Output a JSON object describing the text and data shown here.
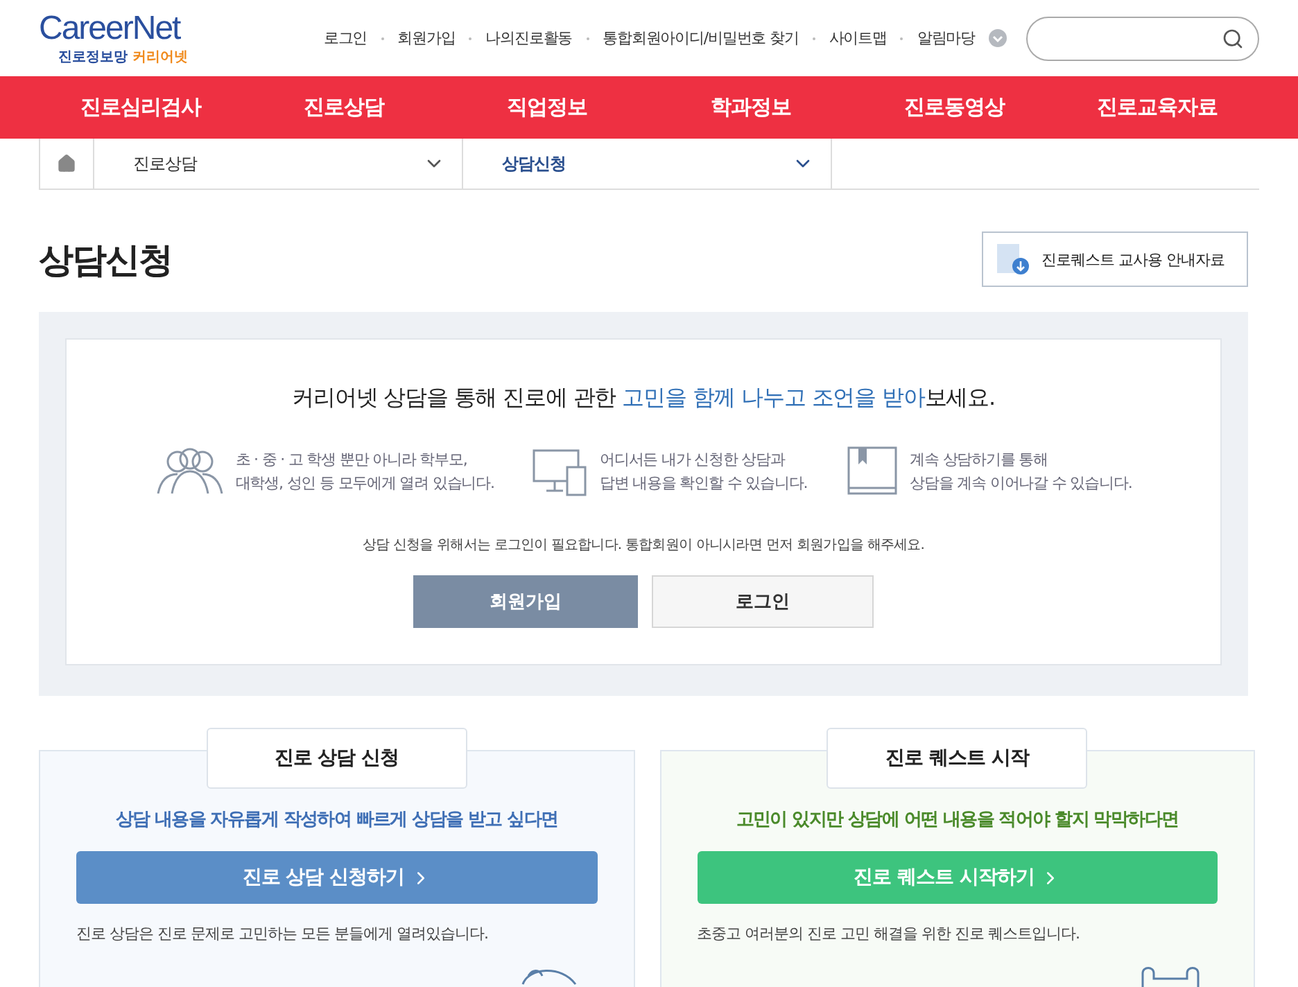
{
  "logo": {
    "brand": "CareerNet",
    "tagline_main": "진로정보망",
    "tagline_sub": "커리어넷"
  },
  "top_links": [
    {
      "label": "로그인"
    },
    {
      "label": "회원가입"
    },
    {
      "label": "나의진로활동"
    },
    {
      "label": "통합회원아이디/비밀번호 찾기"
    },
    {
      "label": "사이트맵"
    },
    {
      "label": "알림마당"
    }
  ],
  "main_nav": [
    {
      "label": "진로심리검사"
    },
    {
      "label": "진로상담"
    },
    {
      "label": "직업정보"
    },
    {
      "label": "학과정보"
    },
    {
      "label": "진로동영상"
    },
    {
      "label": "진로교육자료"
    }
  ],
  "breadcrumb": [
    {
      "label": "진로상담",
      "selected": false
    },
    {
      "label": "상담신청",
      "selected": true
    }
  ],
  "page_title": "상담신청",
  "guide_button": "진로퀘스트 교사용 안내자료",
  "intro": {
    "headline": "커리어넷 상담을 통해 진로에 관한 **고민을 함께 나누고 조언을 받아**보세요.",
    "features": [
      {
        "kind": "people",
        "lines": [
          "초 · 중 · 고 학생 뿐만 아니라 학부모,",
          "대학생, 성인 등 모두에게 열려 있습니다."
        ]
      },
      {
        "kind": "devices",
        "lines": [
          "어디서든 내가 신청한 상담과",
          "답변 내용을 확인할 수 있습니다."
        ]
      },
      {
        "kind": "book",
        "lines": [
          "계속 상담하기를 통해",
          "상담을 계속 이어나갈 수 있습니다."
        ]
      }
    ],
    "notice": "상담 신청을 위해서는 로그인이 필요합니다. 통합회원이 아니시라면 먼저 회원가입을 해주세요.",
    "buttons": [
      {
        "label": "회원가입",
        "kind": "primary"
      },
      {
        "label": "로그인",
        "kind": "secondary"
      }
    ]
  },
  "cards": [
    {
      "tab": "진로 상담 신청",
      "kind": "consult",
      "headline": "상담 내용을 자유롭게 작성하여 빠르게 상담을 받고 싶다면",
      "button": "진로 상담 신청하기",
      "description": "진로 상담은 진로 문제로 고민하는 모든 분들에게 열려있습니다."
    },
    {
      "tab": "진로 퀘스트 시작",
      "kind": "quest",
      "headline": "고민이 있지만 상담에 어떤 내용을 적어야 할지 막막하다면",
      "button": "진로 퀘스트 시작하기",
      "description": "초중고 여러분의 진로 고민 해결을 위한 진로 퀘스트입니다."
    }
  ]
}
